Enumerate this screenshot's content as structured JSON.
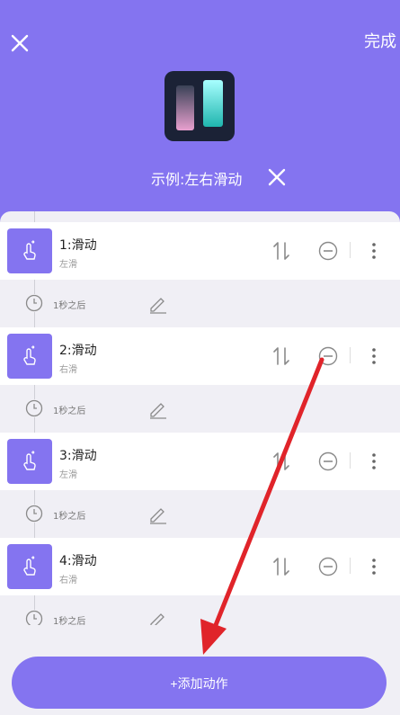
{
  "header": {
    "done_label": "完成",
    "script_title": "示例:左右滑动"
  },
  "actions": [
    {
      "title": "1:滑动",
      "subtitle": "左滑",
      "delay": "1秒之后"
    },
    {
      "title": "2:滑动",
      "subtitle": "右滑",
      "delay": "1秒之后"
    },
    {
      "title": "3:滑动",
      "subtitle": "左滑",
      "delay": "1秒之后"
    },
    {
      "title": "4:滑动",
      "subtitle": "右滑",
      "delay": "1秒之后"
    }
  ],
  "add_button_label": "+添加动作",
  "colors": {
    "accent": "#8474f0",
    "annotation_arrow": "#e0242a",
    "background": "#f0eff5"
  }
}
